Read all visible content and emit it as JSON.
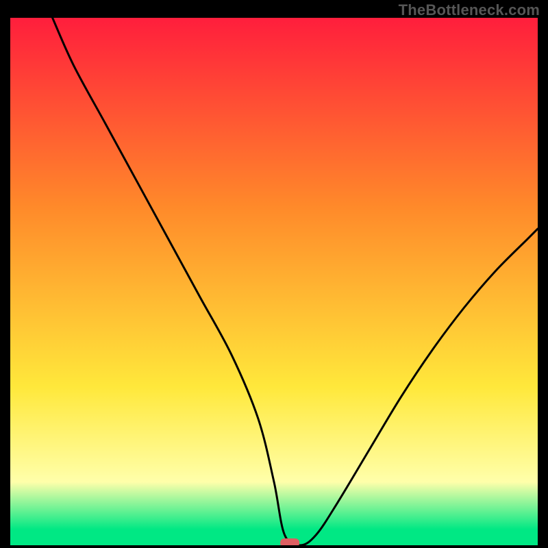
{
  "watermark": "TheBottleneck.com",
  "colors": {
    "frame_bg": "#000000",
    "watermark": "#565656",
    "curve": "#000000",
    "marker": "#de5f62",
    "gradient_red": "#ff1e3c",
    "gradient_orange": "#ff8a2a",
    "gradient_yellow": "#ffe83b",
    "gradient_paleyellow": "#ffffaa",
    "gradient_green": "#00e884"
  },
  "chart_data": {
    "type": "line",
    "title": "",
    "xlabel": "",
    "ylabel": "",
    "xlim": [
      0,
      100
    ],
    "ylim": [
      0,
      100
    ],
    "grid": false,
    "legend": false,
    "marker": {
      "x": 53,
      "y": 0
    },
    "series": [
      {
        "name": "curve",
        "x": [
          8,
          12,
          18,
          24,
          30,
          36,
          42,
          47,
          50,
          52,
          55,
          58,
          62,
          68,
          74,
          80,
          86,
          92,
          98,
          100
        ],
        "y": [
          100,
          91,
          80,
          69,
          58,
          47,
          36,
          24,
          12,
          2,
          0,
          2,
          8,
          18,
          28,
          37,
          45,
          52,
          58,
          60
        ]
      }
    ],
    "background_gradient": [
      {
        "pos": 0.0,
        "color": "#ff1e3c"
      },
      {
        "pos": 0.36,
        "color": "#ff8a2a"
      },
      {
        "pos": 0.7,
        "color": "#ffe83b"
      },
      {
        "pos": 0.88,
        "color": "#ffffaa"
      },
      {
        "pos": 0.97,
        "color": "#00e884"
      },
      {
        "pos": 1.0,
        "color": "#00e884"
      }
    ]
  }
}
